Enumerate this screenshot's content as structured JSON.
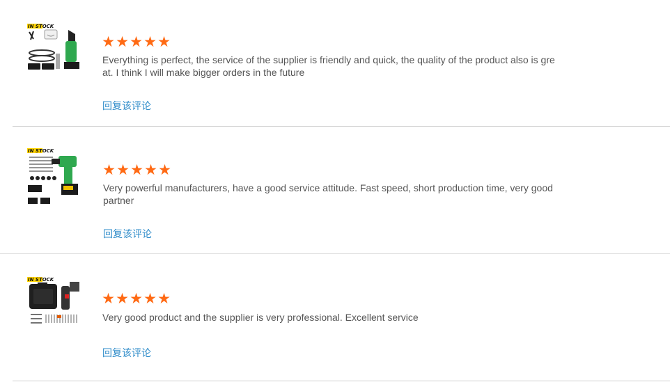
{
  "reviews": [
    {
      "badge": "IN STOCK",
      "rating": 5,
      "text": "Everything is perfect, the service of the supplier is friendly and quick, the quality of the product also is great.  I think I will make bigger orders in the future",
      "reply_label": "回复该评论",
      "product_icon": "mini-chainsaw-kit"
    },
    {
      "badge": "IN STOCK",
      "rating": 5,
      "text": "Very powerful manufacturers, have a good service attitude. Fast speed, short production time, very good partner",
      "reply_label": "回复该评论",
      "product_icon": "impact-wrench-kit"
    },
    {
      "badge": "IN STOCK",
      "rating": 5,
      "text": "Very good product and the supplier is very professional. Excellent service",
      "reply_label": "回复该评论",
      "product_icon": "electric-screwdriver-kit"
    }
  ],
  "star_color": "#ff6a14",
  "link_color": "#2d8bc9"
}
